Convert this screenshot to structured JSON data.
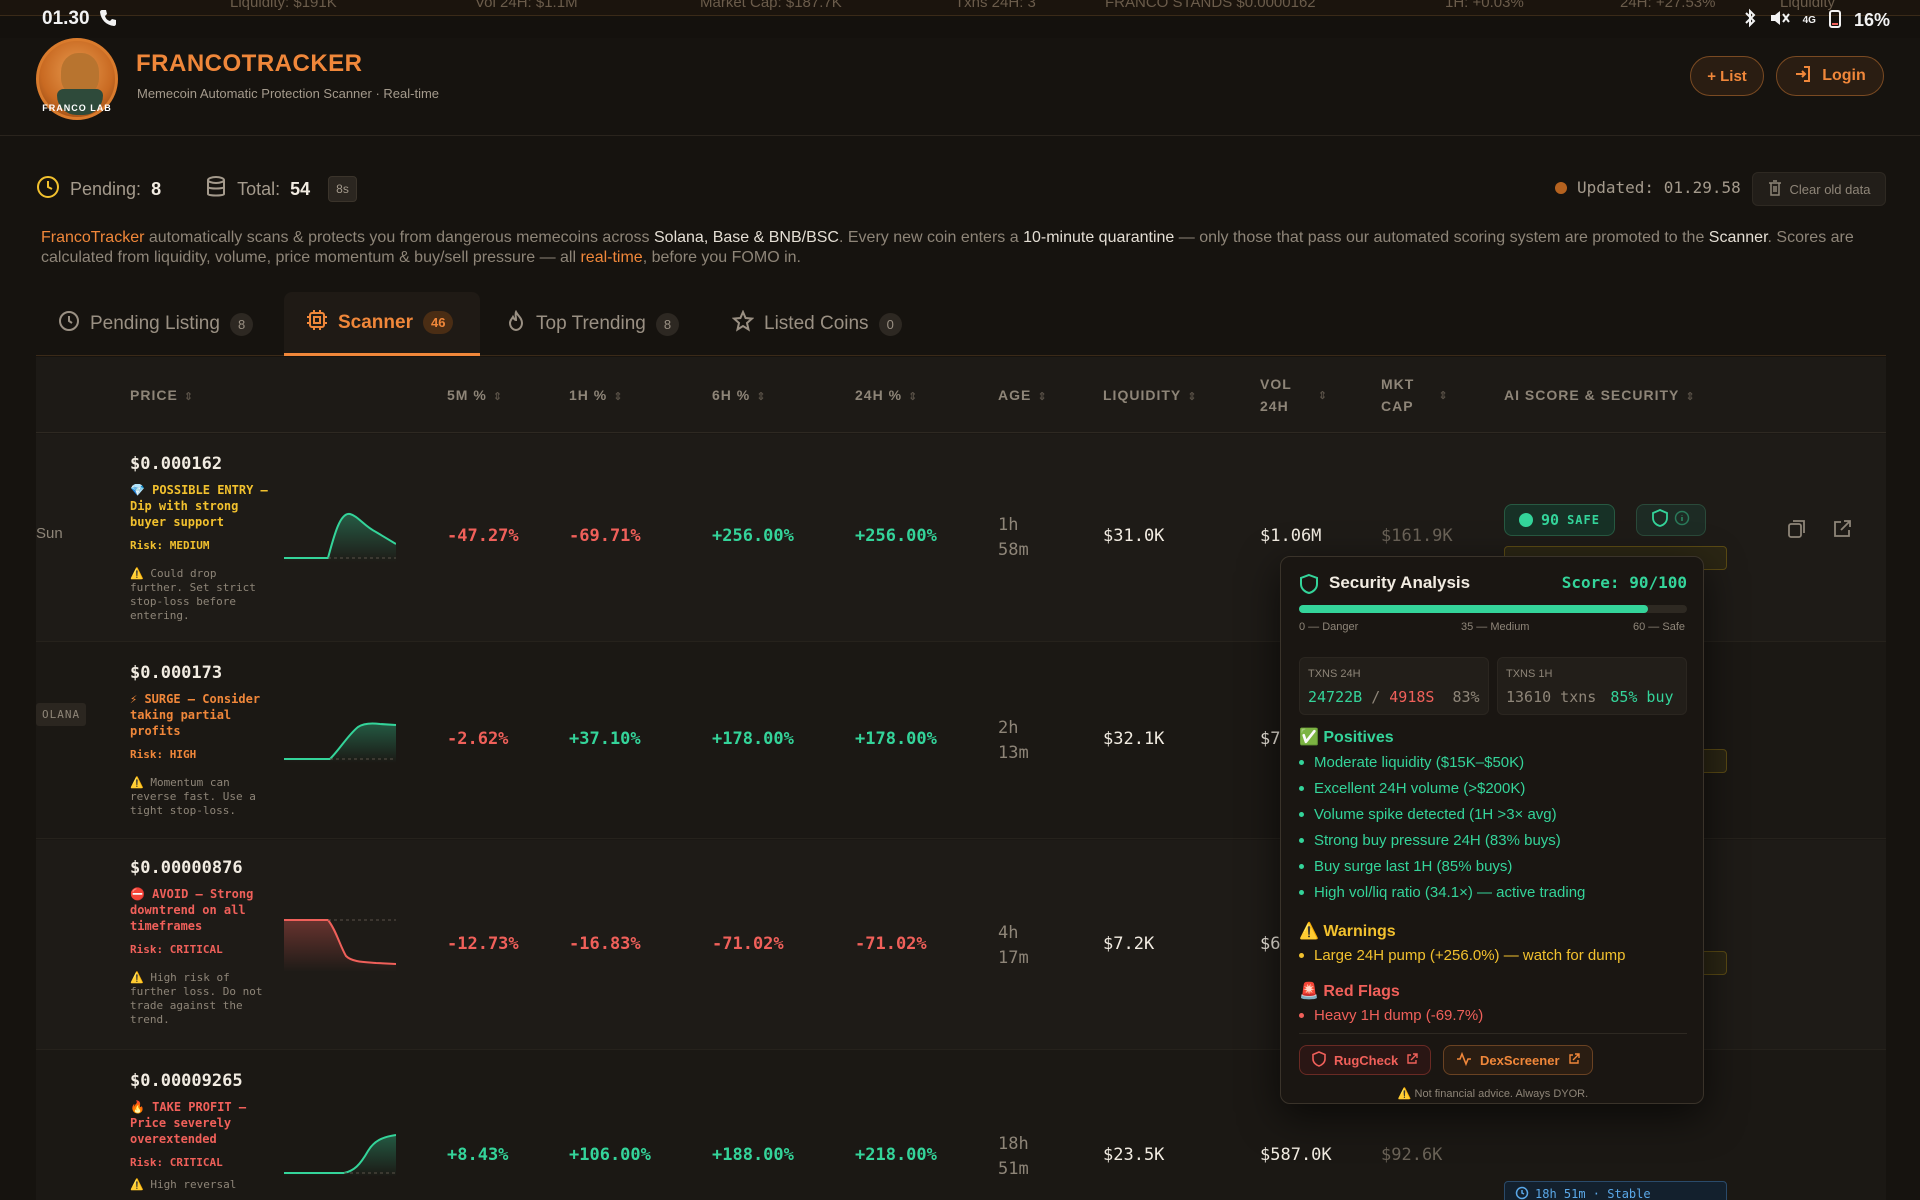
{
  "statusbar": {
    "time": "01.30",
    "battery": "16%",
    "signal": "4G",
    "ticker": [
      "Liquidity: $191K",
      "Vol 24H: $1.1M",
      "Market Cap: $187.7K",
      "Txns 24H: 3",
      "FRANCO STANDS $0.0000162",
      "1H: +0.03%",
      "24H: +27.53%",
      "Liquidity"
    ]
  },
  "header": {
    "brand": "FRANCOTRACKER",
    "tagline": "Memecoin Automatic Protection Scanner · Real-time",
    "logo_text": "FRANCO LAB",
    "list_button": "+ List",
    "login_button": "Login"
  },
  "stats": {
    "pending_label": "Pending:",
    "pending_value": "8",
    "total_label": "Total:",
    "total_value": "54",
    "interval": "8s",
    "updated": "Updated: 01.29.58",
    "clear_button": "Clear old data"
  },
  "intro": {
    "p1": "FrancoTracker",
    "p2": " automatically scans & protects you from dangerous memecoins across ",
    "p3": "Solana, Base & BNB/BSC",
    "p4": ". Every new coin enters a ",
    "p5": "10-minute quarantine",
    "p6": " — only those that pass our automated scoring system are promoted to the ",
    "p7": "Scanner",
    "p8": ". Scores are calculated from liquidity, volume, price momentum & buy/sell pressure — all ",
    "p9": "real-time",
    "p10": ", before you FOMO in."
  },
  "tabs": [
    {
      "label": "Pending Listing",
      "count": "8"
    },
    {
      "label": "Scanner",
      "count": "46"
    },
    {
      "label": "Top Trending",
      "count": "8"
    },
    {
      "label": "Listed Coins",
      "count": "0"
    }
  ],
  "columns": {
    "price": "PRICE",
    "m5": "5M %",
    "h1": "1H %",
    "h6": "6H %",
    "h24": "24H %",
    "age": "AGE",
    "liquidity": "LIQUIDITY",
    "vol_a": "VOL",
    "vol_b": "24H",
    "mcap_a": "MKT",
    "mcap_b": "CAP",
    "score": "AI SCORE & SECURITY"
  },
  "rows": [
    {
      "side": "Sun",
      "price": "$0.000162",
      "signal": "💎 POSSIBLE ENTRY — Dip with strong buyer support",
      "risk": "Risk: MEDIUM",
      "note": "⚠️ Could drop further. Set strict stop-loss before entering.",
      "m5": "-47.27%",
      "h1": "-69.71%",
      "h6": "+256.00%",
      "h24": "+256.00%",
      "age1": "1h",
      "age2": "58m",
      "liquidity": "$31.0K",
      "vol": "$1.06M",
      "mcap": "$161.9K",
      "score": "90",
      "score_label": "SAFE"
    },
    {
      "side": "OLANA",
      "price": "$0.000173",
      "signal": "⚡ SURGE — Consider taking partial profits",
      "risk": "Risk: HIGH",
      "note": "⚠️ Momentum can reverse fast. Use a tight stop-loss.",
      "m5": "-2.62%",
      "h1": "+37.10%",
      "h6": "+178.00%",
      "h24": "+178.00%",
      "age1": "2h",
      "age2": "13m",
      "liquidity": "$32.1K",
      "vol": "$7"
    },
    {
      "price": "$0.00000876",
      "signal": "⛔ AVOID — Strong downtrend on all timeframes",
      "risk": "Risk: CRITICAL",
      "note": "⚠️ High risk of further loss. Do not trade against the trend.",
      "m5": "-12.73%",
      "h1": "-16.83%",
      "h6": "-71.02%",
      "h24": "-71.02%",
      "age1": "4h",
      "age2": "17m",
      "liquidity": "$7.2K",
      "vol": "$6"
    },
    {
      "price": "$0.00009265",
      "signal": "🔥 TAKE PROFIT — Price severely overextended",
      "risk": "Risk: CRITICAL",
      "note": "⚠️ High reversal",
      "m5": "+8.43%",
      "h1": "+106.00%",
      "h6": "+188.00%",
      "h24": "+218.00%",
      "age1": "18h",
      "age2": "51m",
      "liquidity": "$23.5K",
      "vol": "$587.0K",
      "mcap": "$92.6K",
      "stable": "18h 51m · Stable"
    }
  ],
  "popover": {
    "title": "Security Analysis",
    "score": "Score: 90/100",
    "score_value": 90,
    "scale_low": "0 — Danger",
    "scale_mid": "35 — Medium",
    "scale_high": "60 — Safe",
    "tx24_label": "TXNS 24H",
    "tx24_buys": "24722B",
    "tx24_sep": " / ",
    "tx24_sells": "4918S",
    "tx24_pct": "83%",
    "tx1_label": "TXNS 1H",
    "tx1_txns": "13610 txns",
    "tx1_buy": "85% buy",
    "positives_title": "✅ Positives",
    "positives": [
      "Moderate liquidity ($15K–$50K)",
      "Excellent 24H volume (>$200K)",
      "Volume spike detected (1H >3× avg)",
      "Strong buy pressure 24H (83% buys)",
      "Buy surge last 1H (85% buys)",
      "High vol/liq ratio (34.1×) — active trading"
    ],
    "warnings_title": "⚠️ Warnings",
    "warnings": [
      "Large 24H pump (+256.0%) — watch for dump"
    ],
    "redflags_title": "🚨 Red Flags",
    "redflags": [
      "Heavy 1H dump (-69.7%)"
    ],
    "rugcheck": "RugCheck",
    "dexscreener": "DexScreener",
    "disclaimer": "⚠️ Not financial advice. Always DYOR."
  },
  "colors": {
    "accent": "#f0873a",
    "positive": "#34d49a",
    "negative": "#f0605a",
    "warning": "#f2c12e",
    "background": "#16130f"
  }
}
